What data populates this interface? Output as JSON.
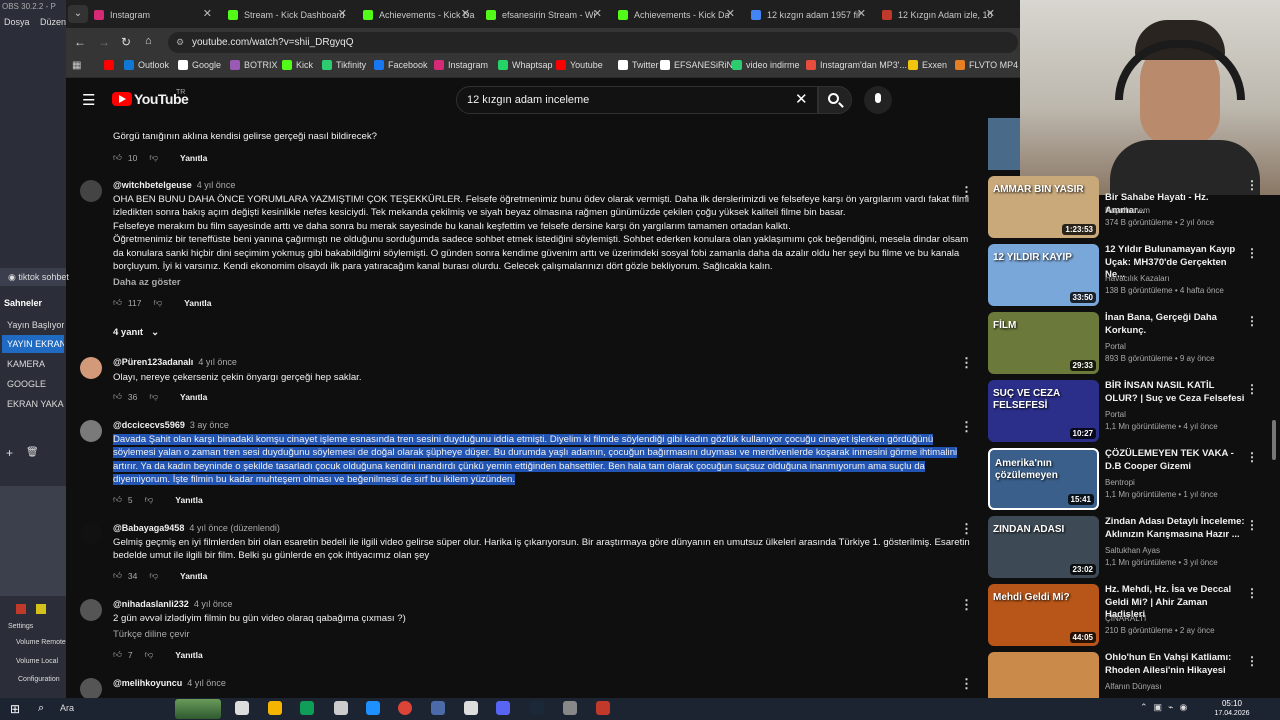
{
  "obs": {
    "title": "OBS 30.2.2 - P",
    "items": [
      "Dosya",
      "Düzen"
    ],
    "tiktok": "tiktok sohbet",
    "scenes_label": "Sahneler",
    "scenes": [
      "Yayın Başlıyor",
      "YAYIN EKRANI",
      "KAMERA",
      "GOOGLE",
      "EKRAN YAKALA"
    ],
    "mixer": [
      "Settings",
      "Volume Remote",
      "Volume Local",
      "Configuration"
    ]
  },
  "tabs": [
    {
      "label": "Instagram",
      "color": "#d62976"
    },
    {
      "label": "Stream - Kick Dashboard",
      "color": "#53fc18"
    },
    {
      "label": "Achievements - Kick Da",
      "color": "#53fc18"
    },
    {
      "label": "efsanesirin Stream - Wi",
      "color": "#53fc18"
    },
    {
      "label": "Achievements - Kick Da",
      "color": "#53fc18"
    },
    {
      "label": "12 kızgın adam 1957 fil",
      "color": "#4285f4"
    },
    {
      "label": "12 Kızgın Adam izle, 10",
      "color": "#c0392b"
    }
  ],
  "url": "youtube.com/watch?v=shii_DRgyqQ",
  "bookmarks": [
    {
      "label": "",
      "color": "#ff0000"
    },
    {
      "label": "Outlook",
      "color": "#0f78d4"
    },
    {
      "label": "Google",
      "color": "#ffffff"
    },
    {
      "label": "BOTRIX",
      "color": "#9b59b6"
    },
    {
      "label": "Kick",
      "color": "#53fc18"
    },
    {
      "label": "Tikfinity",
      "color": "#2ecc71"
    },
    {
      "label": "Facebook",
      "color": "#1877f2"
    },
    {
      "label": "Instagram",
      "color": "#d62976"
    },
    {
      "label": "Whaptsap",
      "color": "#25d366"
    },
    {
      "label": "Youtube",
      "color": "#ff0000"
    },
    {
      "label": "Twitter",
      "color": "#ffffff"
    },
    {
      "label": "EFSANESiRiN",
      "color": "#ffffff"
    },
    {
      "label": "video indirme",
      "color": "#2ecc71"
    },
    {
      "label": "Instagram'dan MP3'...",
      "color": "#e74c3c"
    },
    {
      "label": "Exxen",
      "color": "#f1c40f"
    },
    {
      "label": "FLVTO MP4",
      "color": "#e67e22"
    }
  ],
  "yt": {
    "logo": "YouTube",
    "region": "TR",
    "search": "12 kızgın adam inceleme"
  },
  "comments": [
    {
      "handle": "",
      "time": "",
      "text": "Görgü tanığının aklına kendisi gelirse gerçeği nasıl bildirecek?",
      "likes": "10",
      "reply": "Yanıtla"
    },
    {
      "handle": "@witchbetelgeuse",
      "time": "4 yıl önce",
      "text": "OHA BEN BUNU DAHA ÖNCE YORUMLARA YAZMIŞTIM! ÇOK TEŞEKKÜRLER. Felsefe öğretmenimiz bunu ödev olarak vermişti. Daha ilk derslerimizdi ve felsefeye karşı ön yargılarım vardı fakat filmi izledikten sonra bakış açım değişti kesinlikle nefes kesiciydi. Tek mekanda çekilmiş ve siyah beyaz olmasına rağmen günümüzde çekilen çoğu yüksek kaliteli filme bin basar.\nFelsefeye merakım bu film sayesinde arttı ve daha sonra bu merak sayesinde bu kanalı keşfettim ve felsefe dersine karşı ön yargılarım tamamen ortadan kalktı.\nÖğretmenimiz bir teneffüste beni yanına çağırmıştı ne olduğunu sorduğumda sadece sohbet etmek istediğini söylemişti. Sohbet ederken konulara olan yaklaşımımı çok beğendiğini, mesela dindar olsam da konulara sanki hiçbir dini seçimim yokmuş gibi bakabildiğimi söylemişti. O günden sonra kendime güvenim arttı ve üzerimdeki sosyal fobi zamanla daha da azalır oldu her şeyi bu filme ve bu kanala borçluyum. İyi ki varsınız. Kendi ekonomim olsaydı ilk para yatıracağım kanal burası olurdu. Gelecek çalışmalarınızı dört gözle bekliyorum. Sağlıcakla kalın.",
      "less": "Daha az göster",
      "likes": "117",
      "reply": "Yanıtla",
      "replies": "4 yanıt"
    },
    {
      "handle": "@Püren123adanalı",
      "time": "4 yıl önce",
      "text": "Olayı, nereye çekerseniz çekin önyargı gerçeği hep saklar.",
      "likes": "36",
      "reply": "Yanıtla"
    },
    {
      "handle": "@dccicecvs5969",
      "time": "3 ay önce",
      "text": "Davada Şahit olan karşı binadaki komşu cinayet işleme esnasında tren sesini duyduğunu iddia etmişti. Diyelim ki filmde söylendiği gibi kadın gözlük kullanıyor çocuğu cinayet işlerken gördüğünü söylemesi yalan o zaman tren sesi duyduğunu söylemesi de doğal olarak şüpheye düşer. Bu durumda yaşlı adamın, çocuğun bağırmasını duyması ve merdivenlerde koşarak inmesini görme ihtimalini artırır. Ya da kadın beyninde o şekilde tasarladı çocuk olduğuna kendini inandırdı çünkü yemin ettiğinden bahsettiler. Ben hala tam olarak çocuğun suçsuz olduğuna inanmıyorum ama suçlu da diyemiyorum. İşte filmin bu kadar muhteşem olması ve beğenilmesi de sırf bu ikilem yüzünden.",
      "likes": "5",
      "reply": "Yanıtla"
    },
    {
      "handle": "@Babayaga9458",
      "time": "4 yıl önce (düzenlendi)",
      "text": "Gelmiş geçmiş en iyi filmlerden biri olan esaretin bedeli ile ilgili video gelirse süper olur. Harika iş çıkarıyorsun. Bir araştırmaya göre dünyanın en umutsuz ülkeleri arasında Türkiye 1. gösterilmiş. Esaretin bedelde umut ile ilgili bir film. Belki şu günlerde en çok ihtiyacımız olan şey",
      "likes": "34",
      "reply": "Yanıtla"
    },
    {
      "handle": "@nihadaslanli232",
      "time": "4 yıl önce",
      "text": "2 gün əvvəl  izlədiyim filmin bu gün video olaraq qabağıma çıxması ?)",
      "translate": "Türkçe diline çevir",
      "likes": "7",
      "reply": "Yanıtla"
    },
    {
      "handle": "@melihkoyuncu",
      "time": "4 yıl önce",
      "text": "",
      "likes": "",
      "reply": ""
    }
  ],
  "videos": [
    {
      "title": "Bir Sahabe Hayatı - Hz. Ammar...",
      "channel": "Hayalhanem",
      "meta": "374 B görüntüleme • 2 yıl önce",
      "dur": "1:23:53",
      "thumb": "AMMAR BIN YASIR",
      "color": "#c9a87a"
    },
    {
      "title": "12 Yıldır Bulunamayan Kayıp Uçak: MH370'de Gerçekten Ne...",
      "channel": "Havacılık Kazaları",
      "meta": "138 B görüntüleme • 4 hafta önce",
      "dur": "33:50",
      "thumb": "12 YILDIR KAYIP",
      "color": "#7aa7d9"
    },
    {
      "title": "İnan Bana, Gerçeği Daha Korkunç.",
      "channel": "Portal",
      "meta": "893 B görüntüleme • 9 ay önce",
      "dur": "29:33",
      "thumb": "FİLM",
      "color": "#6b7a3a"
    },
    {
      "title": "BİR İNSAN NASIL KATİL OLUR? | Suç ve Ceza Felsefesi",
      "channel": "Portal",
      "meta": "1,1 Mn görüntüleme • 4 yıl önce",
      "dur": "10:27",
      "thumb": "SUÇ VE CEZA FELSEFESİ",
      "color": "#2b2f8a"
    },
    {
      "title": "ÇÖZÜLEMEYEN TEK VAKA - D.B Cooper Gizemi",
      "channel": "Bentropi",
      "meta": "1,1 Mn görüntüleme • 1 yıl önce",
      "dur": "15:41",
      "thumb": "Amerika'nın çözülemeyen",
      "color": "#3a5f8a"
    },
    {
      "title": "Zindan Adası Detaylı İnceleme: Aklınızın Karışmasına Hazır ...",
      "channel": "Saltukhan Ayas",
      "meta": "1,1 Mn görüntüleme • 3 yıl önce",
      "dur": "23:02",
      "thumb": "ZINDAN ADASI",
      "color": "#3d4a55"
    },
    {
      "title": "Hz. Mehdi, Hz. İsa ve Deccal Geldi Mi? | Ahir Zaman Hadisleri",
      "channel": "ÇINARALTI",
      "meta": "210 B görüntüleme • 2 ay önce",
      "dur": "44:05",
      "thumb": "Mehdi Geldi Mi?",
      "color": "#b8561a"
    },
    {
      "title": "Ohlo'hun En Vahşi Katliamı: Rhoden Ailesi'nin Hikayesi",
      "channel": "Alfanın Dünyası",
      "meta": "",
      "dur": "",
      "thumb": "",
      "color": "#c98a4a"
    }
  ],
  "taskbar": {
    "search": "Ara",
    "time": "05:10",
    "date": "17.04.2026"
  }
}
